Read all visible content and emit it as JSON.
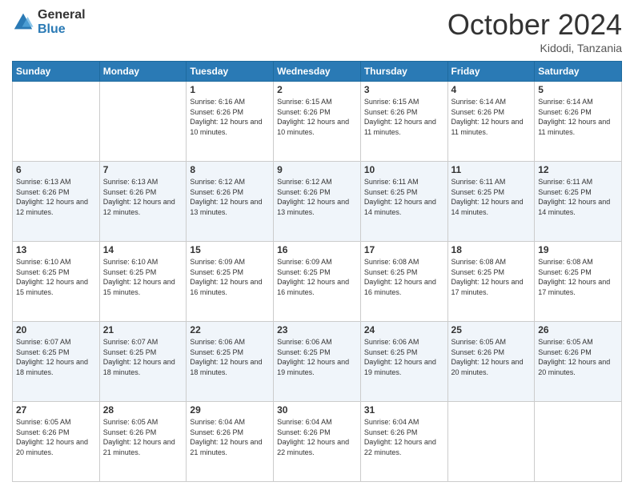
{
  "logo": {
    "general": "General",
    "blue": "Blue"
  },
  "header": {
    "month": "October 2024",
    "location": "Kidodi, Tanzania"
  },
  "days_of_week": [
    "Sunday",
    "Monday",
    "Tuesday",
    "Wednesday",
    "Thursday",
    "Friday",
    "Saturday"
  ],
  "weeks": [
    [
      {
        "day": "",
        "info": ""
      },
      {
        "day": "",
        "info": ""
      },
      {
        "day": "1",
        "info": "Sunrise: 6:16 AM\nSunset: 6:26 PM\nDaylight: 12 hours and 10 minutes."
      },
      {
        "day": "2",
        "info": "Sunrise: 6:15 AM\nSunset: 6:26 PM\nDaylight: 12 hours and 10 minutes."
      },
      {
        "day": "3",
        "info": "Sunrise: 6:15 AM\nSunset: 6:26 PM\nDaylight: 12 hours and 11 minutes."
      },
      {
        "day": "4",
        "info": "Sunrise: 6:14 AM\nSunset: 6:26 PM\nDaylight: 12 hours and 11 minutes."
      },
      {
        "day": "5",
        "info": "Sunrise: 6:14 AM\nSunset: 6:26 PM\nDaylight: 12 hours and 11 minutes."
      }
    ],
    [
      {
        "day": "6",
        "info": "Sunrise: 6:13 AM\nSunset: 6:26 PM\nDaylight: 12 hours and 12 minutes."
      },
      {
        "day": "7",
        "info": "Sunrise: 6:13 AM\nSunset: 6:26 PM\nDaylight: 12 hours and 12 minutes."
      },
      {
        "day": "8",
        "info": "Sunrise: 6:12 AM\nSunset: 6:26 PM\nDaylight: 12 hours and 13 minutes."
      },
      {
        "day": "9",
        "info": "Sunrise: 6:12 AM\nSunset: 6:26 PM\nDaylight: 12 hours and 13 minutes."
      },
      {
        "day": "10",
        "info": "Sunrise: 6:11 AM\nSunset: 6:25 PM\nDaylight: 12 hours and 14 minutes."
      },
      {
        "day": "11",
        "info": "Sunrise: 6:11 AM\nSunset: 6:25 PM\nDaylight: 12 hours and 14 minutes."
      },
      {
        "day": "12",
        "info": "Sunrise: 6:11 AM\nSunset: 6:25 PM\nDaylight: 12 hours and 14 minutes."
      }
    ],
    [
      {
        "day": "13",
        "info": "Sunrise: 6:10 AM\nSunset: 6:25 PM\nDaylight: 12 hours and 15 minutes."
      },
      {
        "day": "14",
        "info": "Sunrise: 6:10 AM\nSunset: 6:25 PM\nDaylight: 12 hours and 15 minutes."
      },
      {
        "day": "15",
        "info": "Sunrise: 6:09 AM\nSunset: 6:25 PM\nDaylight: 12 hours and 16 minutes."
      },
      {
        "day": "16",
        "info": "Sunrise: 6:09 AM\nSunset: 6:25 PM\nDaylight: 12 hours and 16 minutes."
      },
      {
        "day": "17",
        "info": "Sunrise: 6:08 AM\nSunset: 6:25 PM\nDaylight: 12 hours and 16 minutes."
      },
      {
        "day": "18",
        "info": "Sunrise: 6:08 AM\nSunset: 6:25 PM\nDaylight: 12 hours and 17 minutes."
      },
      {
        "day": "19",
        "info": "Sunrise: 6:08 AM\nSunset: 6:25 PM\nDaylight: 12 hours and 17 minutes."
      }
    ],
    [
      {
        "day": "20",
        "info": "Sunrise: 6:07 AM\nSunset: 6:25 PM\nDaylight: 12 hours and 18 minutes."
      },
      {
        "day": "21",
        "info": "Sunrise: 6:07 AM\nSunset: 6:25 PM\nDaylight: 12 hours and 18 minutes."
      },
      {
        "day": "22",
        "info": "Sunrise: 6:06 AM\nSunset: 6:25 PM\nDaylight: 12 hours and 18 minutes."
      },
      {
        "day": "23",
        "info": "Sunrise: 6:06 AM\nSunset: 6:25 PM\nDaylight: 12 hours and 19 minutes."
      },
      {
        "day": "24",
        "info": "Sunrise: 6:06 AM\nSunset: 6:25 PM\nDaylight: 12 hours and 19 minutes."
      },
      {
        "day": "25",
        "info": "Sunrise: 6:05 AM\nSunset: 6:26 PM\nDaylight: 12 hours and 20 minutes."
      },
      {
        "day": "26",
        "info": "Sunrise: 6:05 AM\nSunset: 6:26 PM\nDaylight: 12 hours and 20 minutes."
      }
    ],
    [
      {
        "day": "27",
        "info": "Sunrise: 6:05 AM\nSunset: 6:26 PM\nDaylight: 12 hours and 20 minutes."
      },
      {
        "day": "28",
        "info": "Sunrise: 6:05 AM\nSunset: 6:26 PM\nDaylight: 12 hours and 21 minutes."
      },
      {
        "day": "29",
        "info": "Sunrise: 6:04 AM\nSunset: 6:26 PM\nDaylight: 12 hours and 21 minutes."
      },
      {
        "day": "30",
        "info": "Sunrise: 6:04 AM\nSunset: 6:26 PM\nDaylight: 12 hours and 22 minutes."
      },
      {
        "day": "31",
        "info": "Sunrise: 6:04 AM\nSunset: 6:26 PM\nDaylight: 12 hours and 22 minutes."
      },
      {
        "day": "",
        "info": ""
      },
      {
        "day": "",
        "info": ""
      }
    ]
  ]
}
